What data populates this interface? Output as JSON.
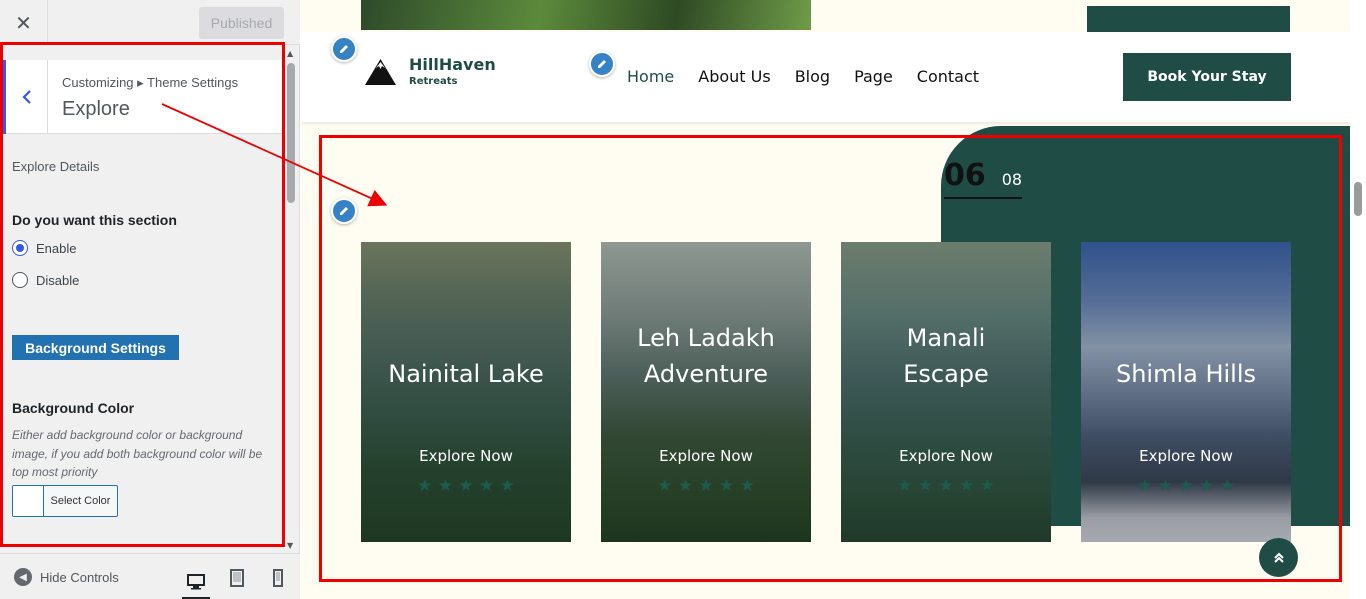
{
  "customizer": {
    "close_label": "✕",
    "publish_label": "Published",
    "breadcrumb": "Customizing ▸ Theme Settings",
    "panel_title": "Explore",
    "section_label": "Explore Details",
    "question": "Do you want this section",
    "options": [
      {
        "label": "Enable",
        "selected": true
      },
      {
        "label": "Disable",
        "selected": false
      }
    ],
    "bg_settings_label": "Background Settings",
    "bg_color_title": "Background Color",
    "bg_color_desc": "Either add background color or background image, if you add both background color will be top most priority",
    "select_color_label": "Select Color",
    "hide_controls_label": "Hide Controls",
    "device_preview": [
      "desktop",
      "tablet",
      "mobile"
    ],
    "active_device": "desktop"
  },
  "site": {
    "brand_name": "HillHaven",
    "brand_sub": "Retreats",
    "nav": [
      "Home",
      "About Us",
      "Blog",
      "Page",
      "Contact"
    ],
    "nav_active": "Home",
    "cta_label": "Book Your Stay",
    "counter_current": "06",
    "counter_total": "08",
    "cards": [
      {
        "title": "Nainital Lake",
        "action": "Explore Now",
        "stars": "★ ★ ★ ★ ★"
      },
      {
        "title": "Leh Ladakh Adventure",
        "action": "Explore Now",
        "stars": "★ ★ ★ ★ ★"
      },
      {
        "title": "Manali Escape",
        "action": "Explore Now",
        "stars": "★ ★ ★ ★ ★"
      },
      {
        "title": "Shimla Hills",
        "action": "Explore Now",
        "stars": "★ ★ ★ ★ ★"
      }
    ],
    "scroll_top_icon": "double-chevron-up-icon"
  },
  "colors": {
    "accent_blue": "#3858e9",
    "brand_green": "#1f4d45",
    "highlight_red": "#e00000",
    "page_cream": "#fffcf2"
  }
}
